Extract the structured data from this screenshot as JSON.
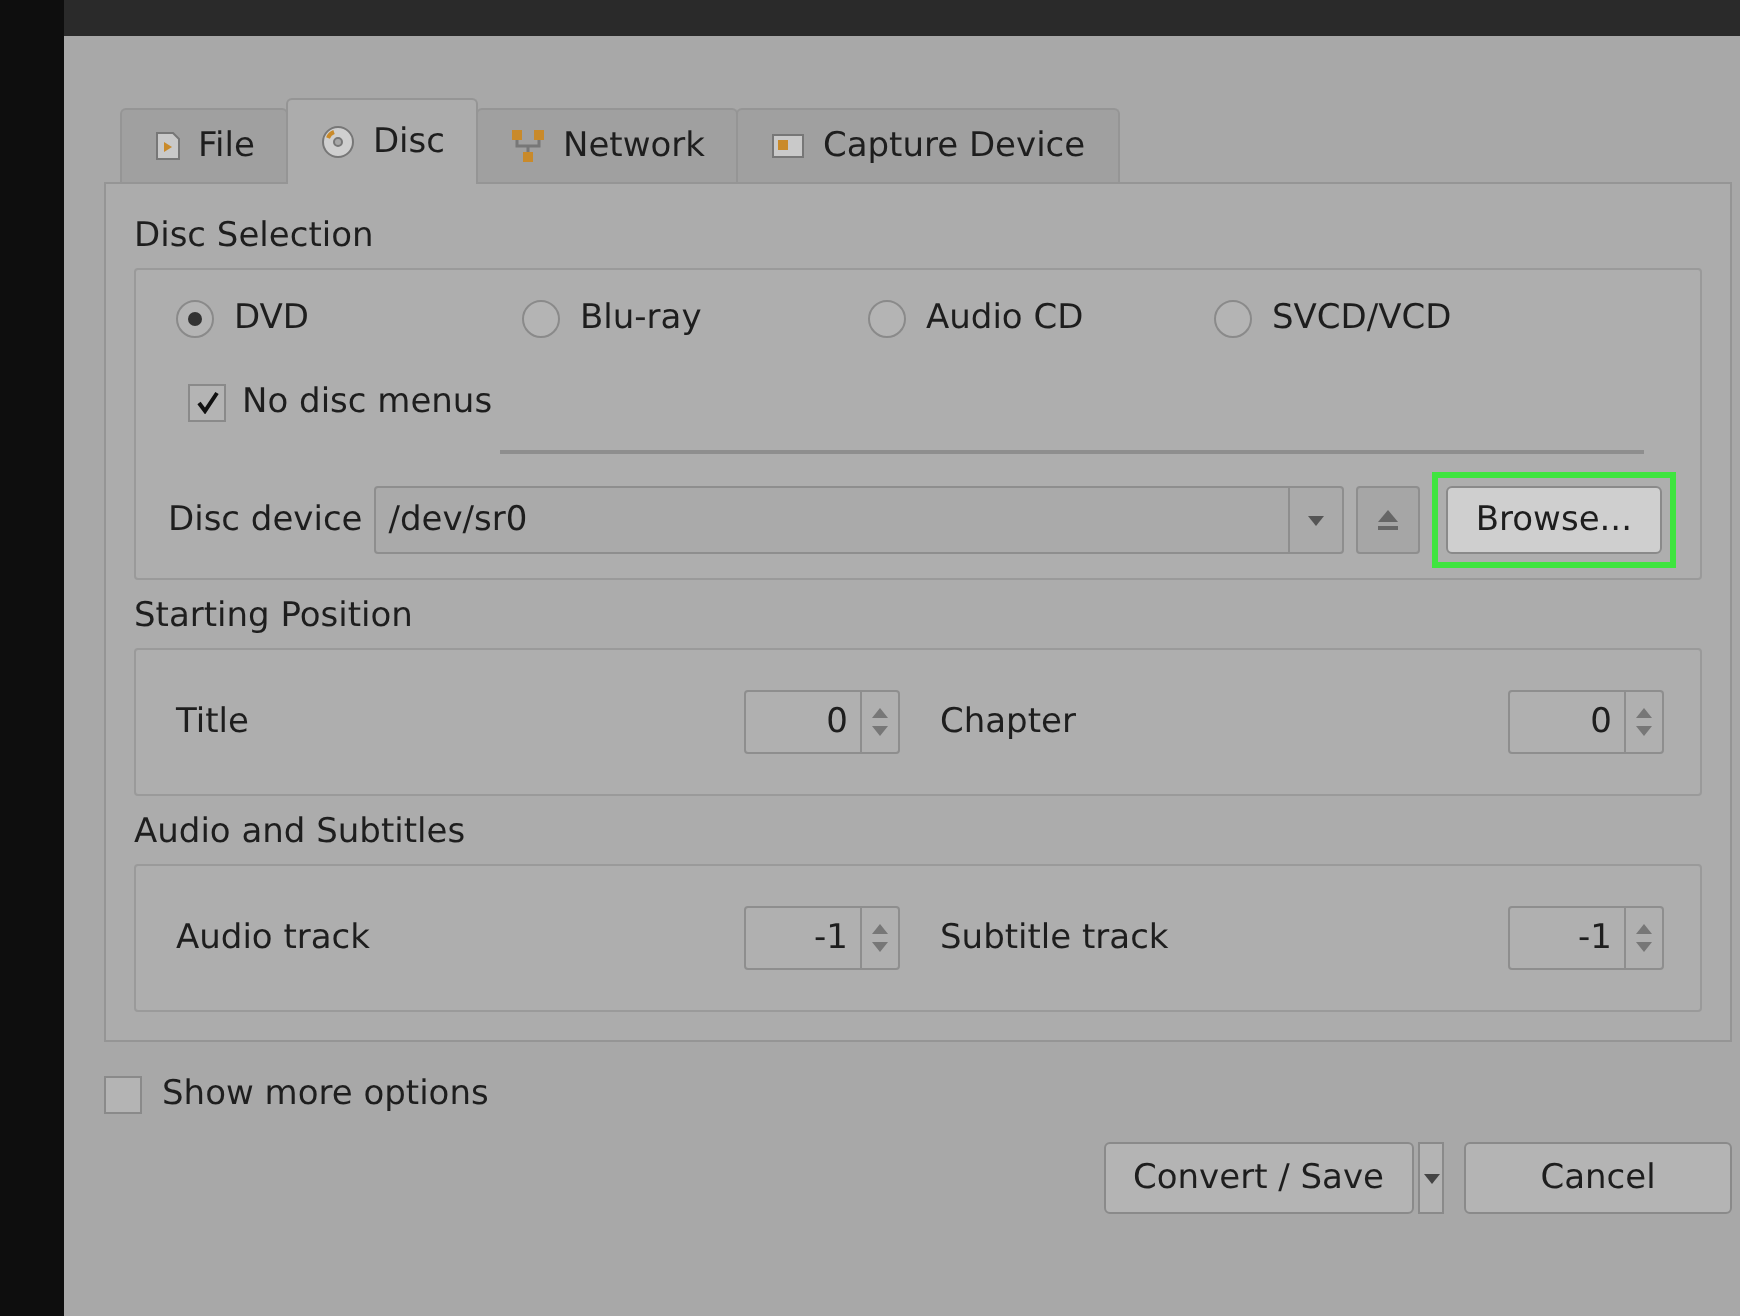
{
  "tabs": [
    {
      "label": "File",
      "kind": "file",
      "selected": false
    },
    {
      "label": "Disc",
      "kind": "disc",
      "selected": true
    },
    {
      "label": "Network",
      "kind": "network",
      "selected": false
    },
    {
      "label": "Capture Device",
      "kind": "capture",
      "selected": false
    }
  ],
  "disc_selection": {
    "title": "Disc Selection",
    "disc_types": [
      {
        "label": "DVD",
        "selected": true
      },
      {
        "label": "Blu-ray",
        "selected": false
      },
      {
        "label": "Audio CD",
        "selected": false
      },
      {
        "label": "SVCD/VCD",
        "selected": false
      }
    ],
    "no_disc_menus": {
      "label": "No disc menus",
      "checked": true
    },
    "disc_device": {
      "label": "Disc device",
      "value": "/dev/sr0",
      "browse": "Browse...",
      "browse_highlighted": true
    }
  },
  "starting_position": {
    "title": "Starting Position",
    "fields": [
      {
        "label": "Title",
        "value": "0"
      },
      {
        "label": "Chapter",
        "value": "0"
      }
    ]
  },
  "audio_subtitles": {
    "title": "Audio and Subtitles",
    "fields": [
      {
        "label": "Audio track",
        "value": "-1"
      },
      {
        "label": "Subtitle track",
        "value": "-1"
      }
    ]
  },
  "show_more_options": {
    "label": "Show more options",
    "checked": false
  },
  "buttons": {
    "convert": "Convert / Save",
    "cancel": "Cancel"
  }
}
